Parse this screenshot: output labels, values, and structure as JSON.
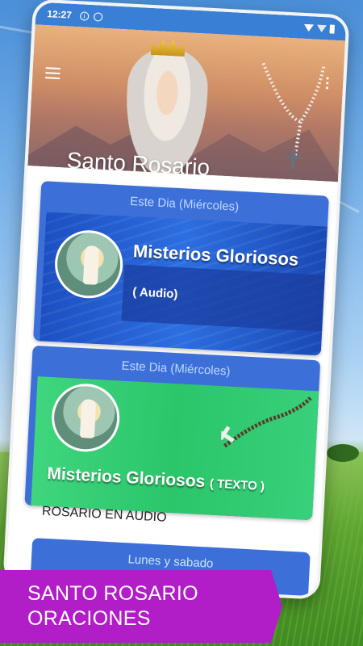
{
  "status_bar": {
    "time": "12:27"
  },
  "header": {
    "title": "Santo Rosario"
  },
  "cards": [
    {
      "day_label": "Este Dia (Miércoles)",
      "title": "Misterios Gloriosos",
      "subtitle": "( Audio)"
    },
    {
      "day_label": "Este Dia (Miércoles)",
      "title": "Misterios Gloriosos",
      "subtitle": "( TEXTO )"
    }
  ],
  "list": {
    "item_label": "ROSARIO EN AUDIO"
  },
  "next_card": {
    "label": "Lunes y sabado"
  },
  "caption": {
    "line1": "SANTO ROSARIO",
    "line2": "ORACIONES"
  },
  "colors": {
    "accent": "#3d6fd8",
    "caption": "#b11dc7",
    "status_bar": "#3a7fd6"
  }
}
